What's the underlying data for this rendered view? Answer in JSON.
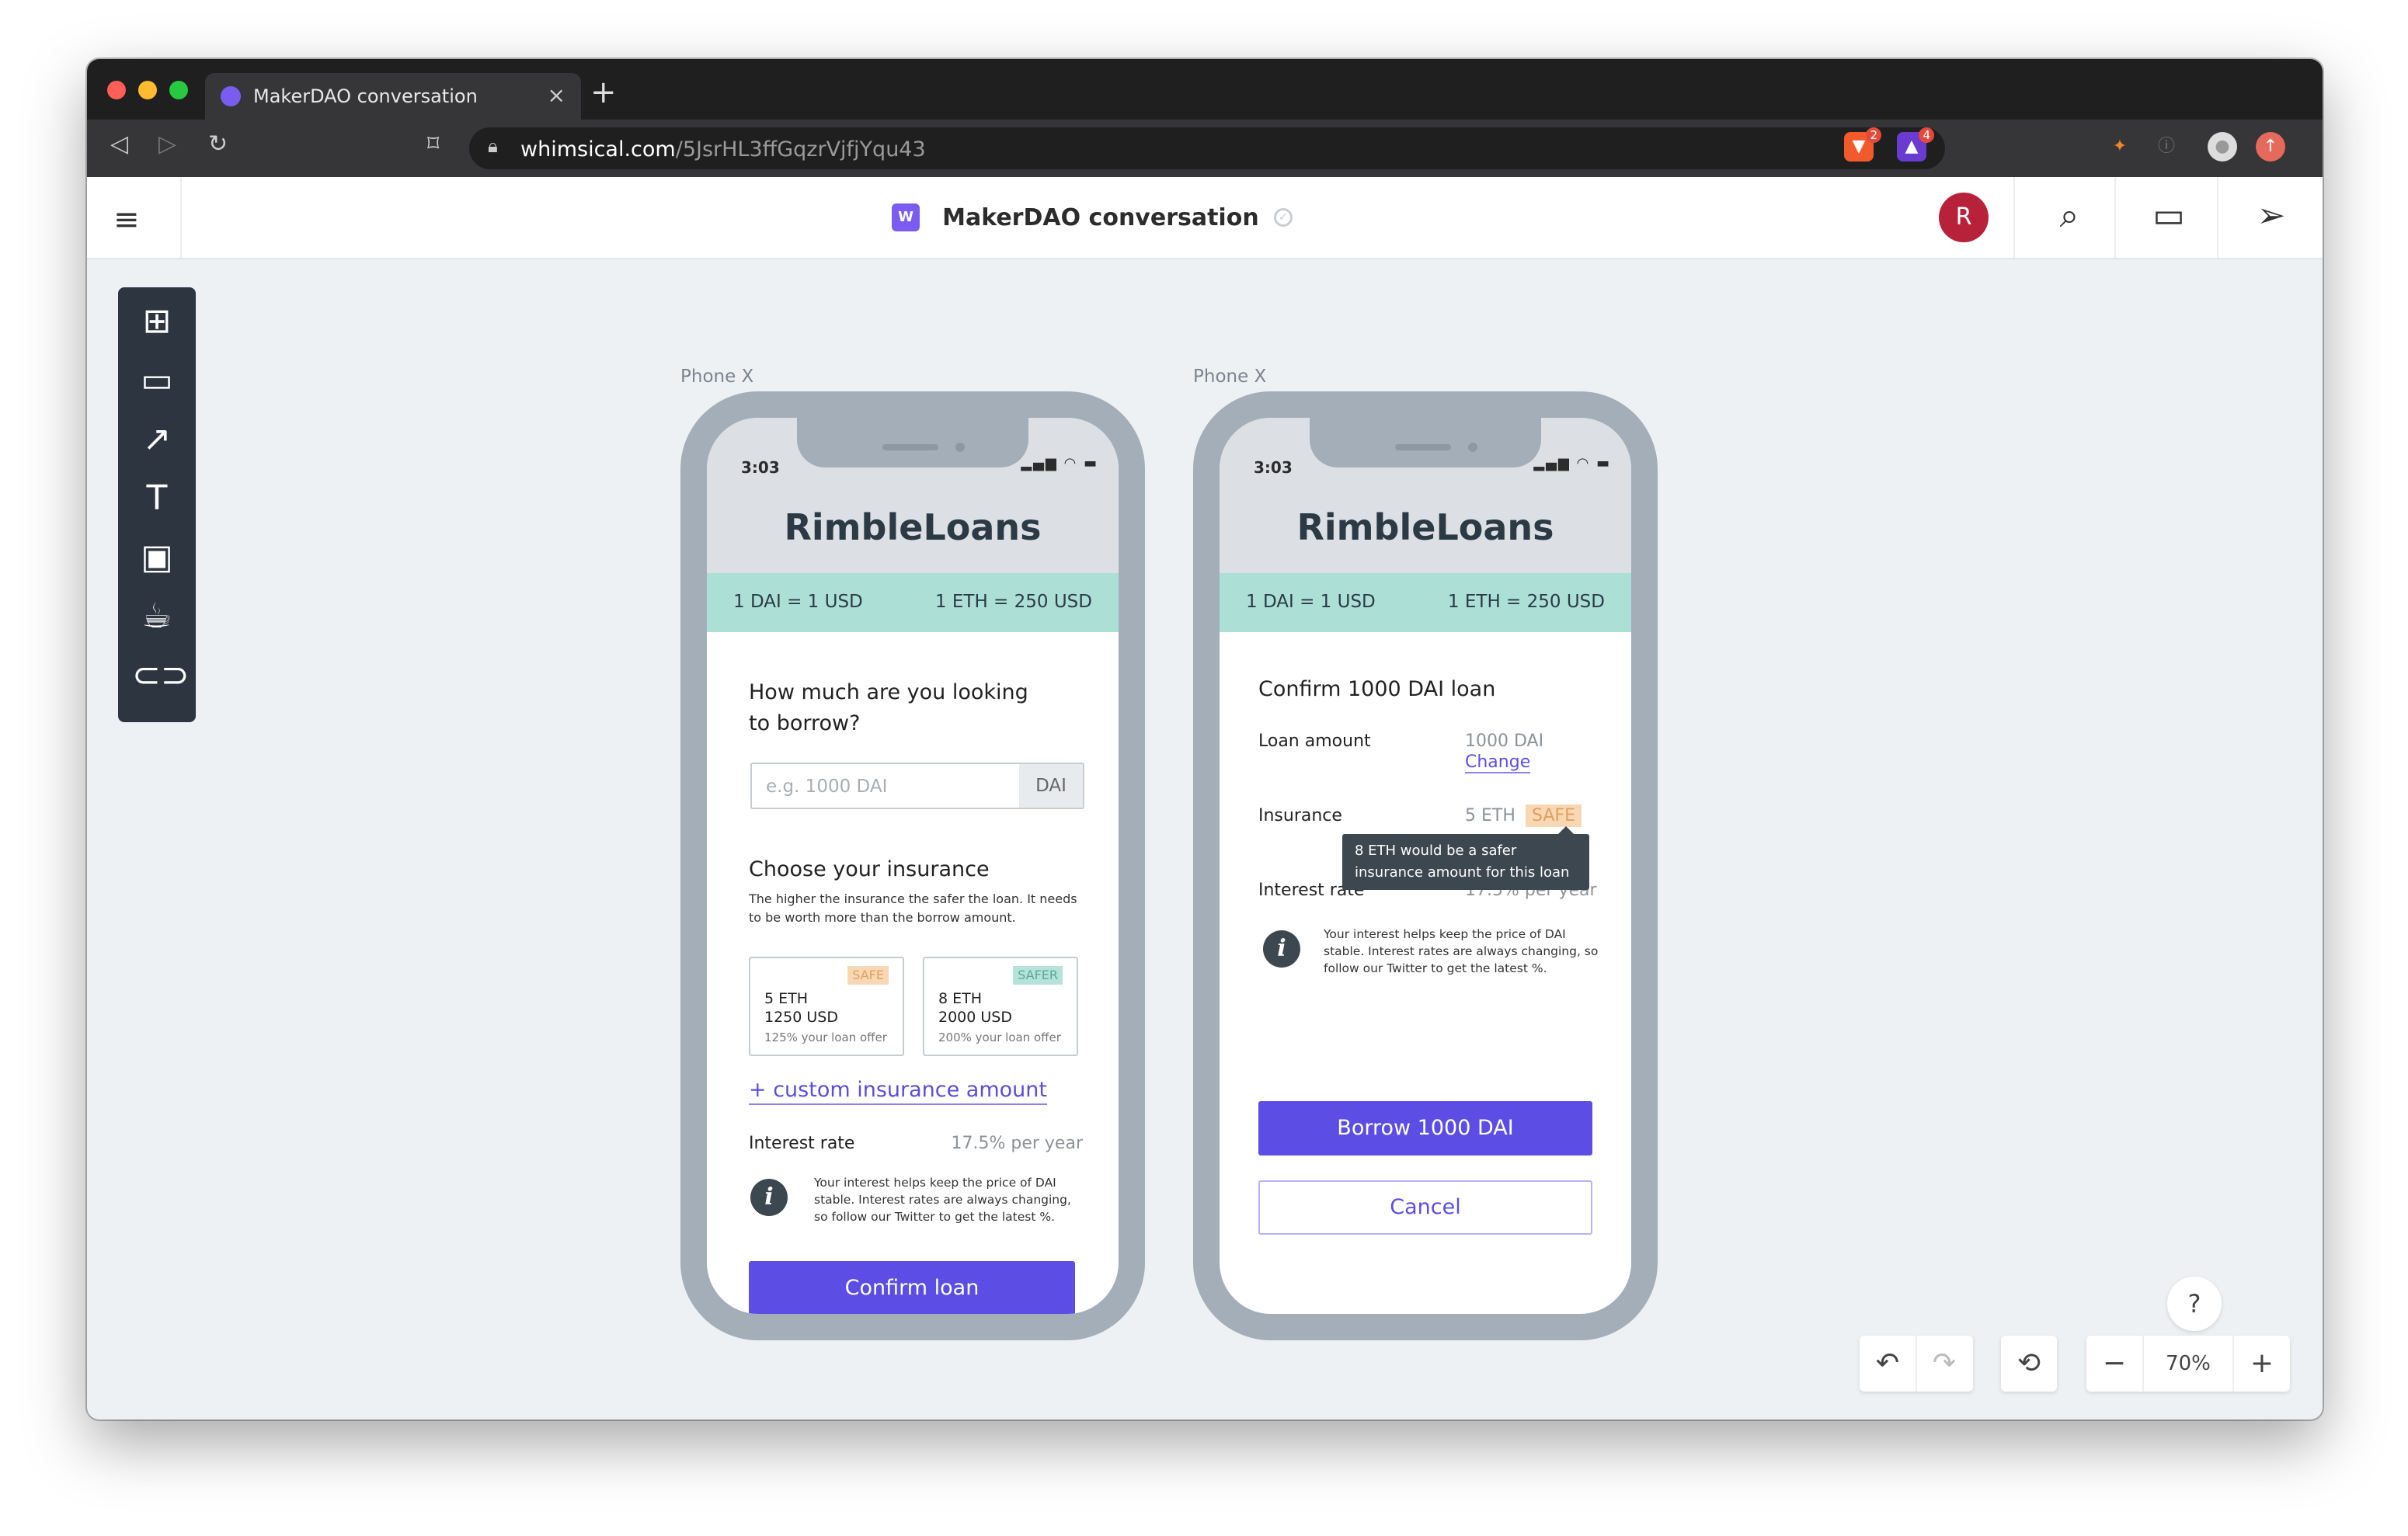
{
  "browser": {
    "tab_title": "MakerDAO conversation",
    "tab_close": "×",
    "new_tab": "+",
    "url_domain": "whimsical.com",
    "url_path": "/5JsrHL3ffGqzrVjfjYqu43",
    "ext_brave_badge": "2",
    "ext_alert_badge": "4"
  },
  "app": {
    "doc_badge": "W",
    "doc_title": "MakerDAO conversation",
    "avatar_initial": "R"
  },
  "frames": [
    {
      "label": "Phone X"
    },
    {
      "label": "Phone X"
    }
  ],
  "phone": {
    "time": "3:03",
    "brand": "RimbleLoans",
    "rate_dai": "1 DAI = 1 USD",
    "rate_eth": "1 ETH = 250 USD"
  },
  "screen1": {
    "question": "How much are you looking to borrow?",
    "input_placeholder": "e.g. 1000 DAI",
    "input_suffix": "DAI",
    "insurance_title": "Choose your insurance",
    "insurance_desc": "The higher the insurance the safer the loan. It needs to be worth more than the borrow amount.",
    "options": [
      {
        "tag": "SAFE",
        "eth": "5 ETH",
        "usd": "1250 USD",
        "note": "125% your loan offer"
      },
      {
        "tag": "SAFER",
        "eth": "8 ETH",
        "usd": "2000 USD",
        "note": "200% your loan offer"
      }
    ],
    "custom_link": "+ custom insurance amount",
    "interest_label": "Interest rate",
    "interest_value": "17.5% per year",
    "info_text": "Your interest helps keep the price of DAI stable. Interest rates are always changing, so follow our Twitter to get the latest %.",
    "confirm_button": "Confirm loan"
  },
  "screen2": {
    "title": "Confirm 1000 DAI loan",
    "loan_label": "Loan amount",
    "loan_value": "1000 DAI",
    "change_link": "Change",
    "insurance_label": "Insurance",
    "insurance_value": "5 ETH",
    "insurance_tag": "SAFE",
    "tooltip": "8 ETH would be a safer insurance amount for this loan",
    "interest_label": "Interest rate",
    "interest_value": "17.5% per year",
    "info_text": "Your interest helps keep the price of DAI stable. Interest rates are always changing, so follow our Twitter to get the latest %.",
    "borrow_button": "Borrow 1000 DAI",
    "cancel_button": "Cancel"
  },
  "controls": {
    "zoom": "70%",
    "zoom_out": "−",
    "zoom_in": "+",
    "help": "?"
  },
  "colors": {
    "accent": "#5c4ee5",
    "brand_purple": "#7b5cf0",
    "rates_band": "#ace0d6",
    "safe_tag": "#f8d7b4",
    "safer_tag": "#b5e2d9",
    "avatar": "#b8213a"
  }
}
